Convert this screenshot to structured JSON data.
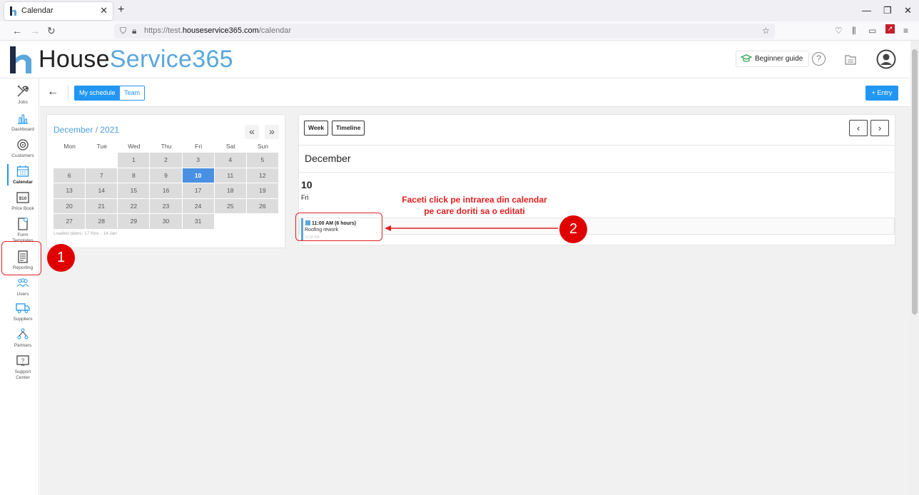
{
  "browser": {
    "tab_title": "Calendar",
    "url_prefix": "https://test.",
    "url_domain": "houseservice365.com",
    "url_path": "/calendar"
  },
  "header": {
    "logo_part1": "House",
    "logo_part2": "Service365",
    "beginner_guide": "Beginner guide",
    "help_symbol": "?"
  },
  "sidebar": {
    "items": [
      {
        "label": "Jobs",
        "icon": "tools-icon"
      },
      {
        "label": "Dashboard",
        "icon": "bar-chart-icon"
      },
      {
        "label": "Customers",
        "icon": "target-icon"
      },
      {
        "label": "Calendar",
        "icon": "calendar-icon"
      },
      {
        "label": "Price Book",
        "icon": "price-tag-icon"
      },
      {
        "label": "Form Templates",
        "icon": "form-template-icon"
      },
      {
        "label": "Reporting",
        "icon": "report-icon"
      },
      {
        "label": "Users",
        "icon": "users-icon"
      },
      {
        "label": "Suppliers",
        "icon": "truck-icon"
      },
      {
        "label": "Partners",
        "icon": "network-icon"
      },
      {
        "label": "Support Center",
        "icon": "question-icon"
      }
    ]
  },
  "toolbar": {
    "my_schedule": "My schedule",
    "team": "Team",
    "entry": "+ Entry"
  },
  "minical": {
    "title": "December / 2021",
    "prev": "«",
    "next": "»",
    "weekdays": [
      "Mon",
      "Tue",
      "Wed",
      "Thu",
      "Fri",
      "Sat",
      "Sun"
    ],
    "weeks": [
      [
        "",
        "",
        "1",
        "2",
        "3",
        "4",
        "5"
      ],
      [
        "6",
        "7",
        "8",
        "9",
        "10",
        "11",
        "12"
      ],
      [
        "13",
        "14",
        "15",
        "16",
        "17",
        "18",
        "19"
      ],
      [
        "20",
        "21",
        "22",
        "23",
        "24",
        "25",
        "26"
      ],
      [
        "27",
        "28",
        "29",
        "30",
        "31",
        "",
        ""
      ]
    ],
    "selected": "10",
    "loaded_dates": "Loaded dates: 17 Nov - 14 Jan"
  },
  "schedule": {
    "week_btn": "Week",
    "timeline_btn": "Timeline",
    "prev": "‹",
    "next": "›",
    "month": "December",
    "day_number": "10",
    "day_name": "Fri",
    "event": {
      "time": "11:00 AM (6 hours)",
      "title": "Roofing rework",
      "faint": "11:00 AM"
    }
  },
  "annotations": {
    "step1": "1",
    "step2": "2",
    "instruction_line1": "Faceti click pe intrarea din calendar",
    "instruction_line2": "pe care doriti sa o editati",
    "color": "#e02020"
  }
}
